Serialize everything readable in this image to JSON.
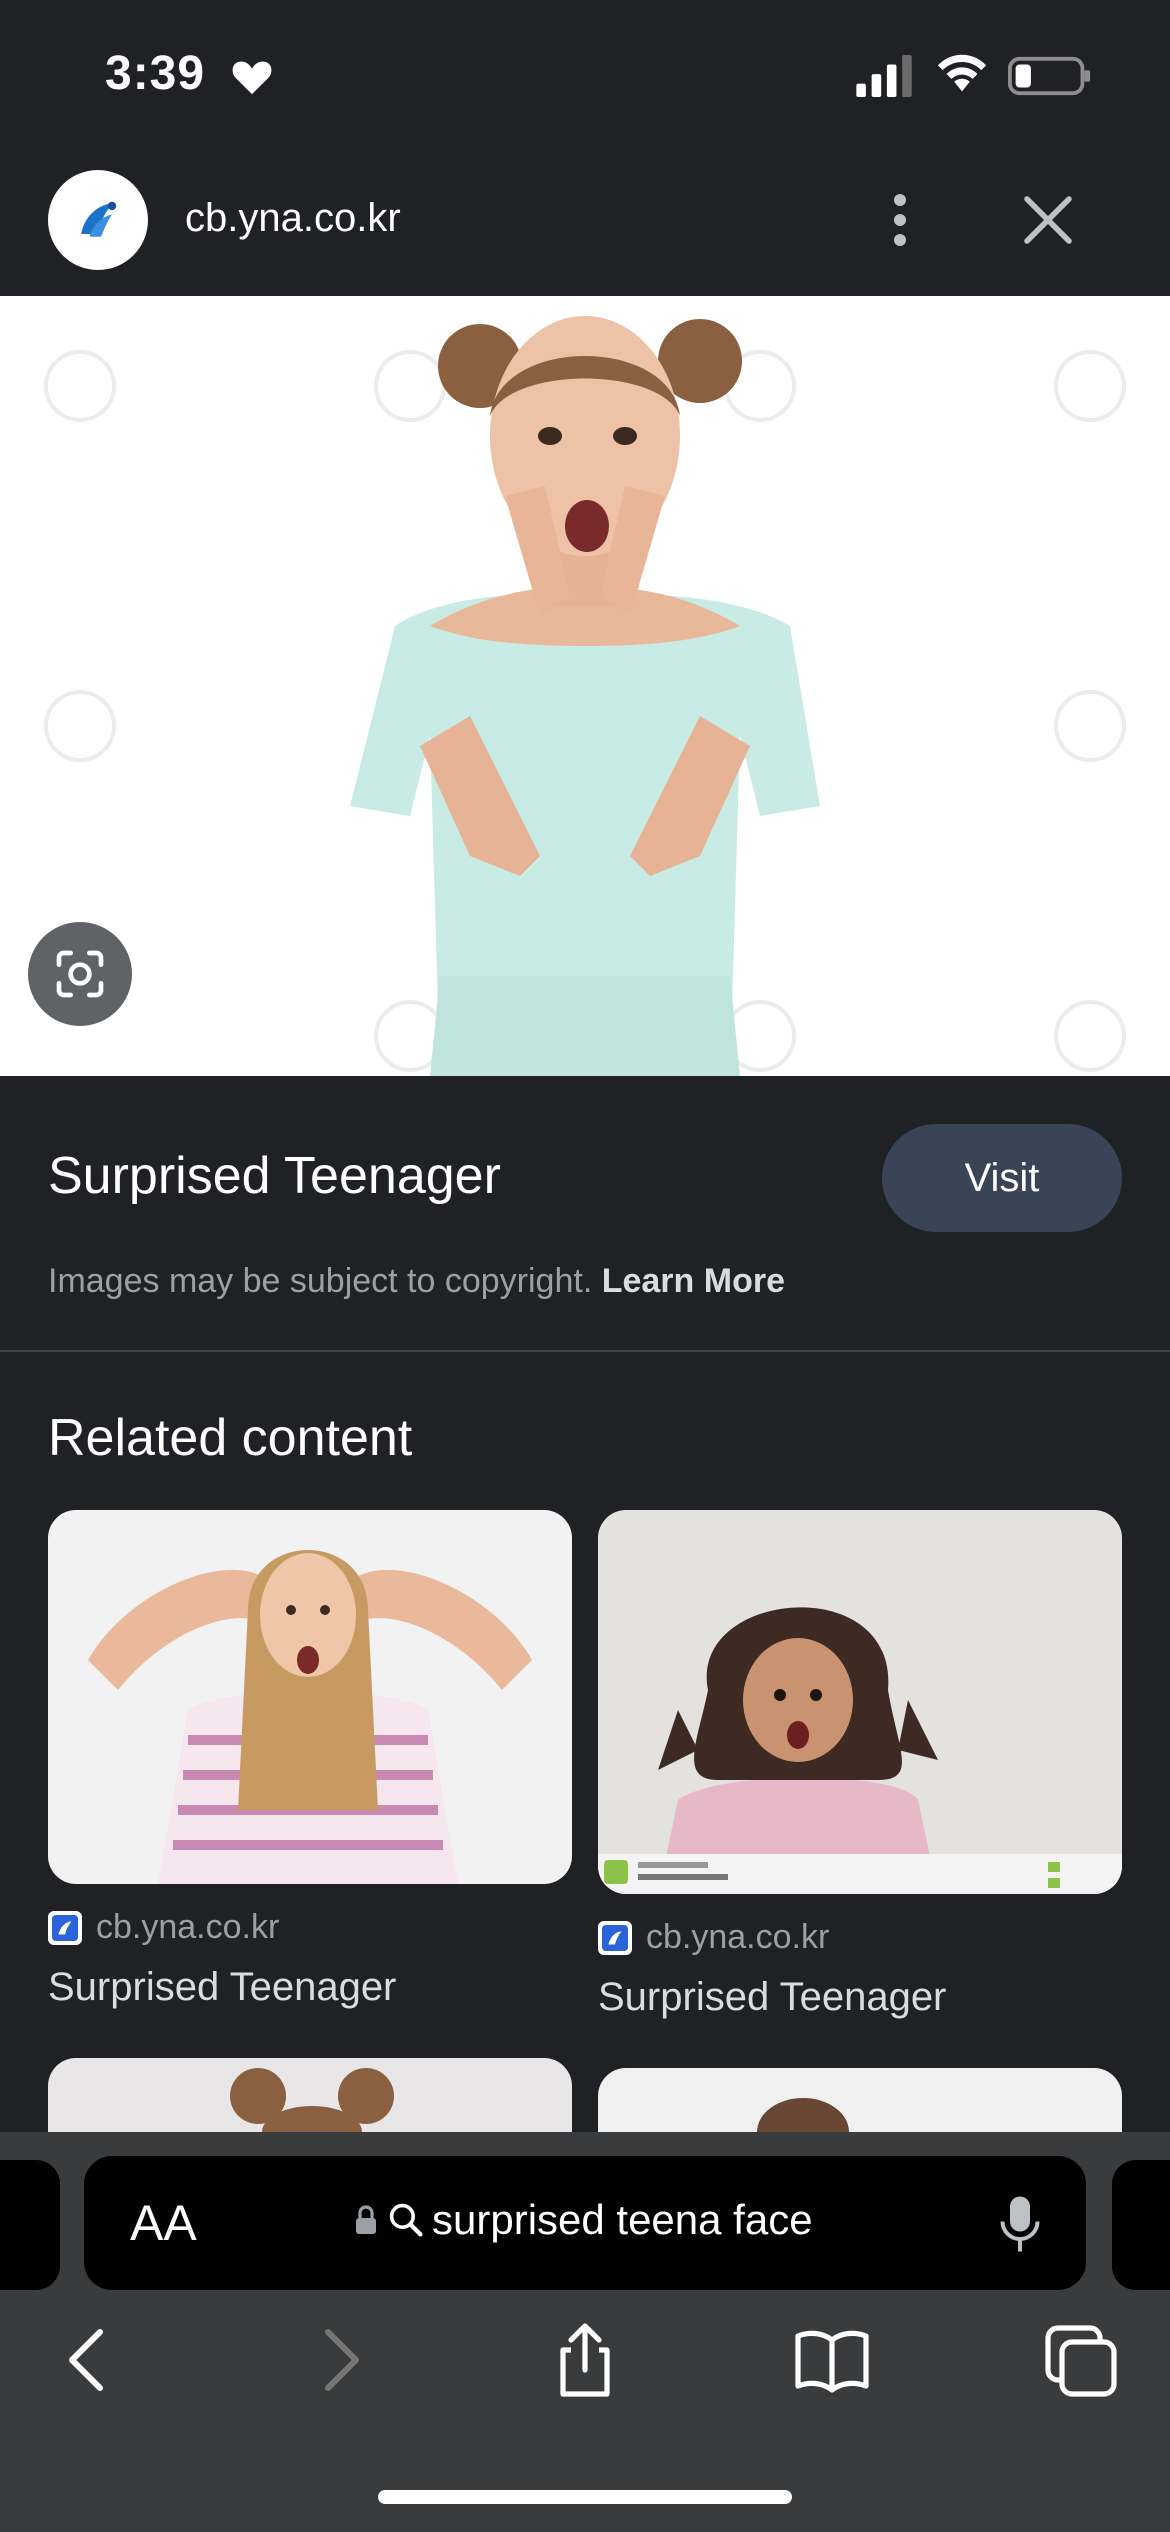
{
  "status_bar": {
    "time": "3:39"
  },
  "header": {
    "site": "cb.yna.co.kr"
  },
  "info": {
    "title": "Surprised Teenager",
    "visit_label": "Visit",
    "copyright_text": "Images may be subject to copyright.",
    "learn_more": "Learn More"
  },
  "related": {
    "title": "Related content",
    "items": [
      {
        "source": "cb.yna.co.kr",
        "title": "Surprised Teenager"
      },
      {
        "source": "cb.yna.co.kr",
        "title": "Surprised Teenager"
      }
    ]
  },
  "browser": {
    "text_size_label": "AA",
    "search_text": "surprised teena face"
  },
  "colors": {
    "background": "#202124",
    "visit_button": "#394457",
    "toolbar": "#3a3b3d"
  }
}
